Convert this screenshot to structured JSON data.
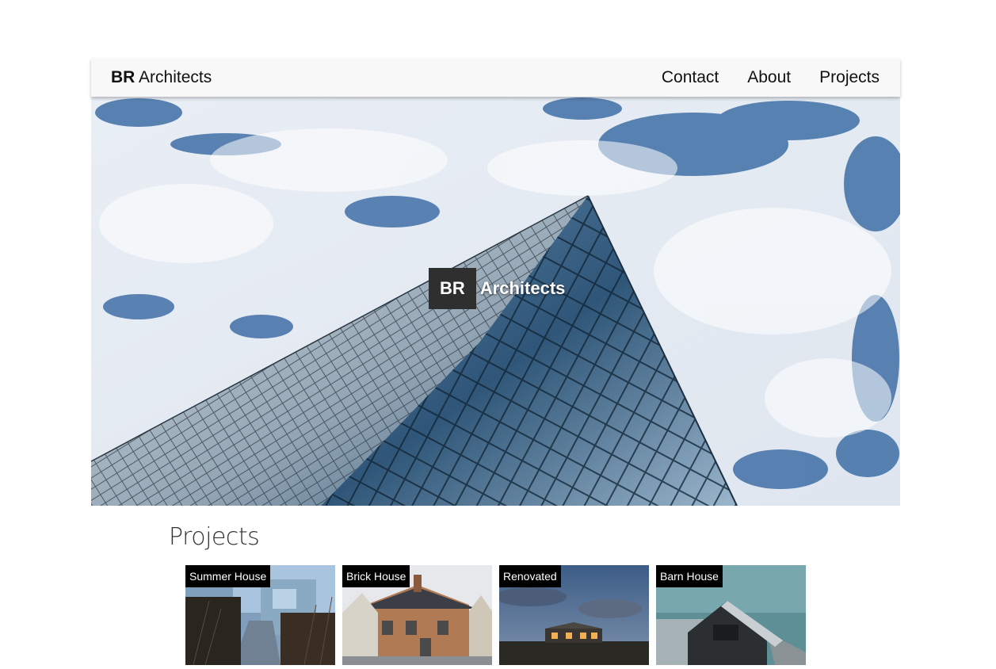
{
  "navbar": {
    "brand_bold": "BR",
    "brand_rest": "Architects",
    "links": [
      "Contact",
      "About",
      "Projects"
    ]
  },
  "hero": {
    "title_box": "BR",
    "title_rest": "Architects"
  },
  "projects": {
    "heading": "Projects",
    "items": [
      {
        "label": "Summer House"
      },
      {
        "label": "Brick House"
      },
      {
        "label": "Renovated"
      },
      {
        "label": "Barn House"
      }
    ]
  },
  "colors": {
    "navbar_bg": "#f8f8f9",
    "title_box_bg": "#2f2f2f",
    "sky_blue": "#3d6fa8"
  }
}
